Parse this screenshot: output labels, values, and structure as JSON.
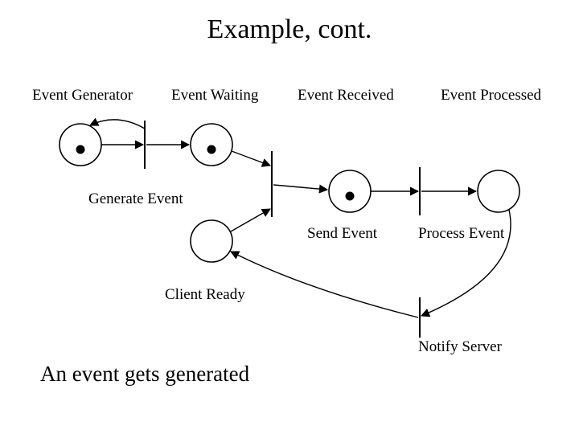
{
  "title": "Example, cont.",
  "labels": {
    "event_generator": "Event Generator",
    "event_waiting": "Event Waiting",
    "event_received": "Event Received",
    "event_processed": "Event Processed",
    "generate_event": "Generate Event",
    "send_event": "Send Event",
    "process_event": "Process Event",
    "client_ready": "Client Ready",
    "notify_server": "Notify Server"
  },
  "caption": "An event gets generated"
}
